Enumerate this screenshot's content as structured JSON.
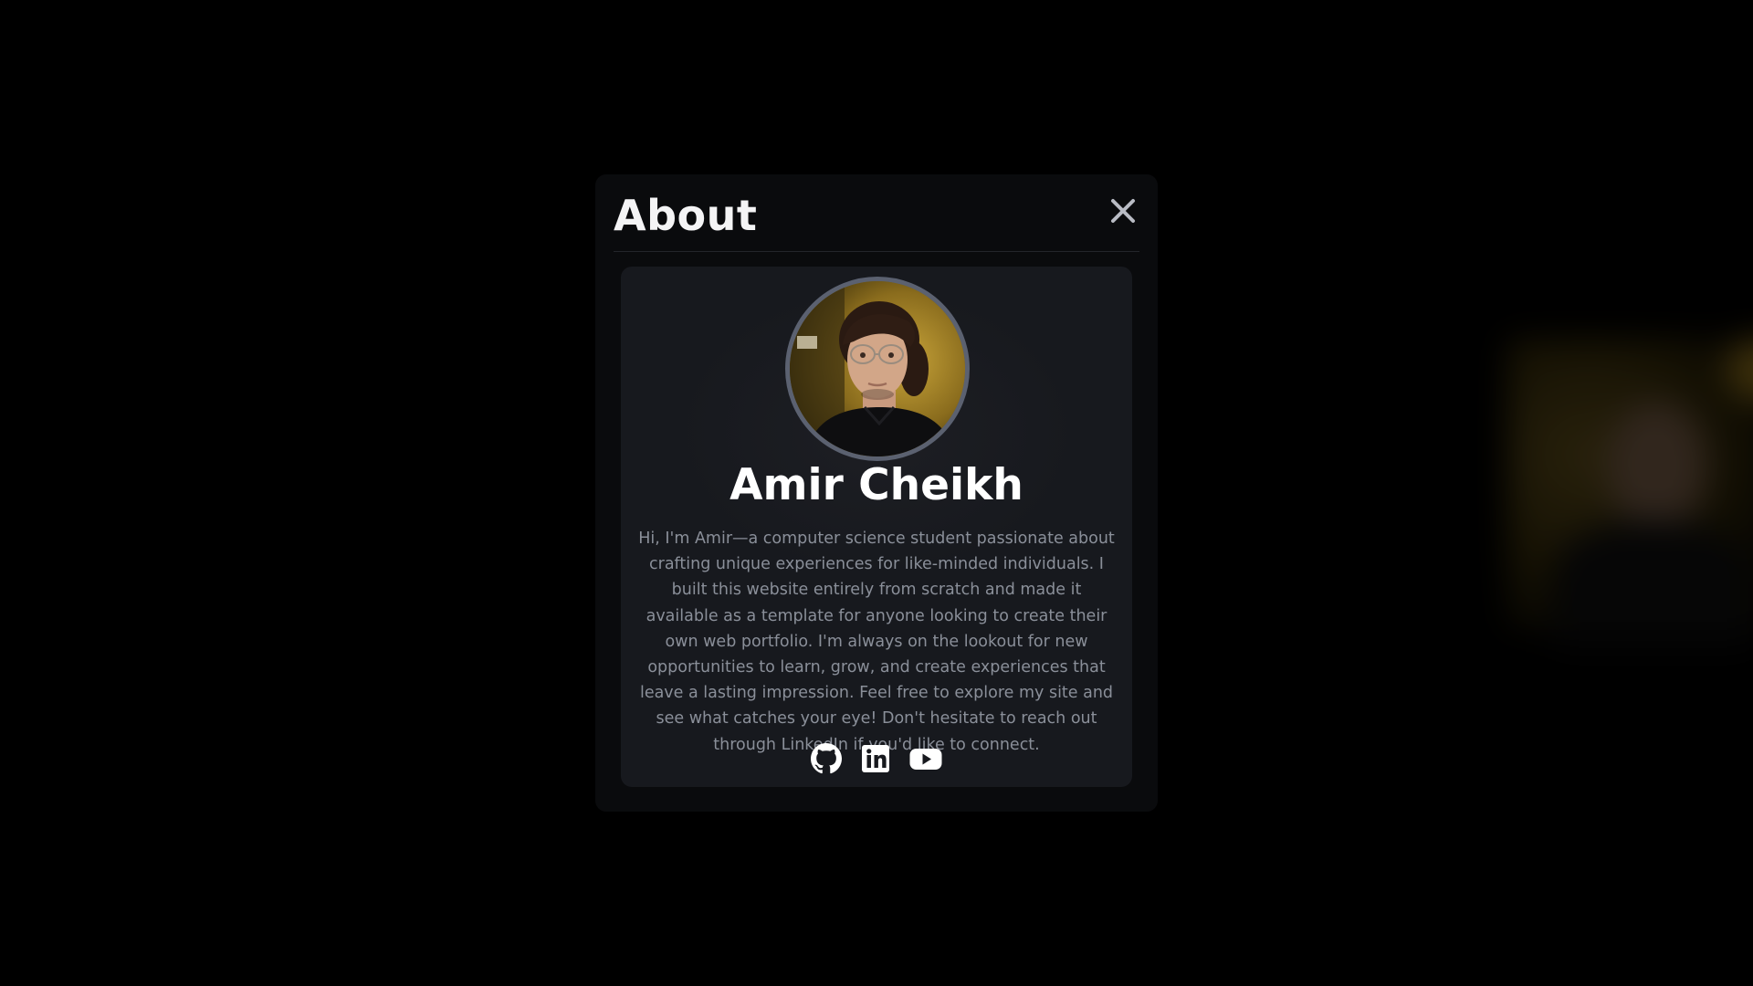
{
  "modal": {
    "title": "About",
    "close_icon": "close-icon"
  },
  "profile": {
    "name": "Amir Cheikh",
    "bio": "Hi, I'm Amir—a computer science student passionate about crafting unique experiences for like-minded individuals. I built this website entirely from scratch and made it available as a template for anyone looking to create their own web portfolio. I'm always on the lookout for new opportunities to learn, grow, and create experiences that leave a lasting impression. Feel free to explore my site and see what catches your eye! Don't hesitate to reach out through LinkedIn if you'd like to connect.",
    "socials": [
      {
        "icon": "github-icon"
      },
      {
        "icon": "linkedin-icon"
      },
      {
        "icon": "youtube-icon"
      }
    ]
  },
  "colors": {
    "page_background": "#000000",
    "modal_background": "#0a0b0d",
    "card_background": "#17191e",
    "avatar_border": "#5b6170",
    "name_text": "#ffffff",
    "bio_text": "#8a8f99"
  }
}
